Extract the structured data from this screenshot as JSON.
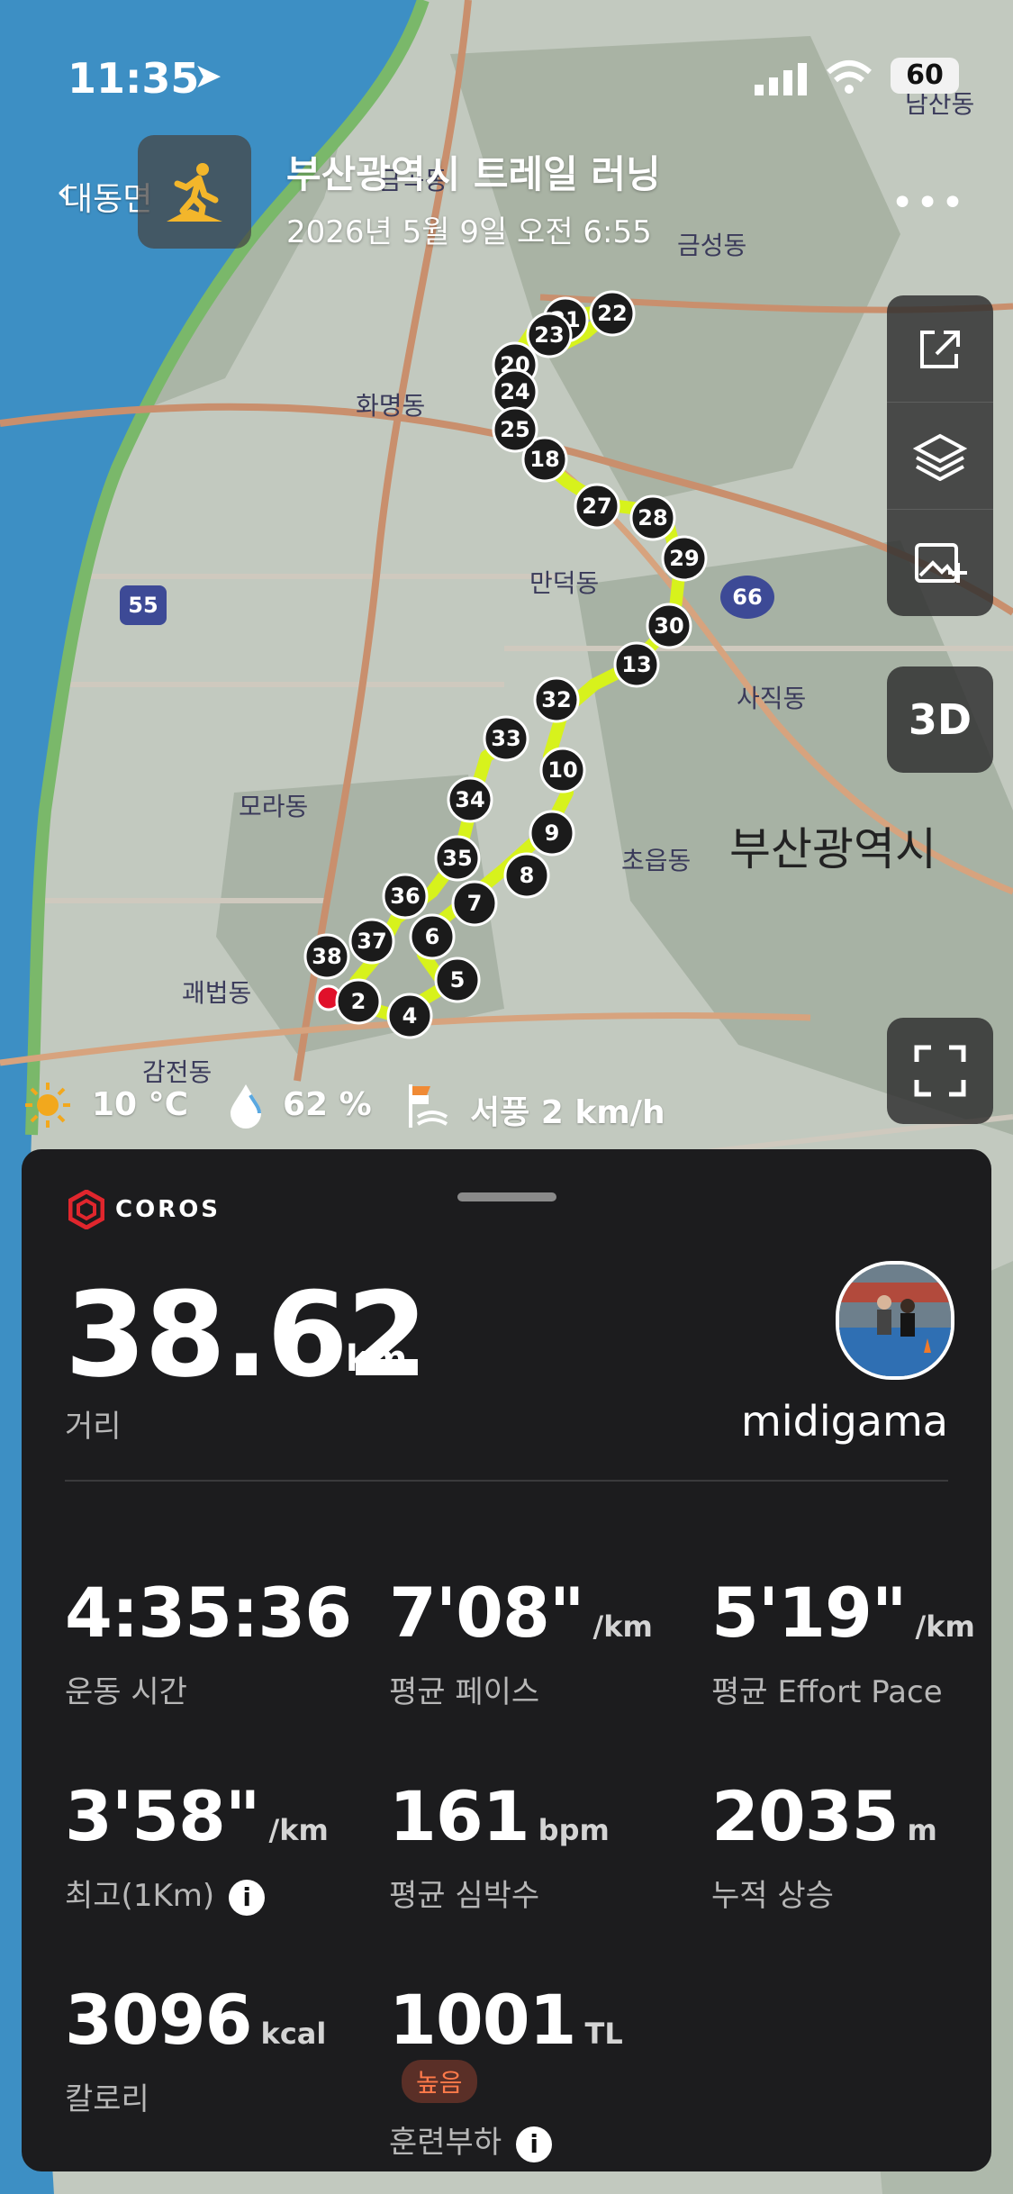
{
  "status_bar": {
    "time": "11:35",
    "battery": "60"
  },
  "header": {
    "back_label": "대동면",
    "title": "부산광역시 트레일 러닝",
    "subtitle": "2026년 5월 9일 오전 6:55"
  },
  "map": {
    "places": [
      "금곡동",
      "금성동",
      "화명동",
      "만덕동",
      "사직동",
      "모라동",
      "초읍동",
      "부산광역시",
      "괘법동",
      "감전동",
      "남산동"
    ],
    "road_labels": [
      "55",
      "66"
    ],
    "km_markers": [
      "2",
      "4",
      "5",
      "6",
      "7",
      "8",
      "9",
      "10",
      "13",
      "18",
      "20",
      "21",
      "22",
      "23",
      "24",
      "25",
      "27",
      "28",
      "29",
      "30",
      "32",
      "33",
      "34",
      "35",
      "36",
      "37",
      "38"
    ]
  },
  "map_controls": {
    "three_d_label": "3D"
  },
  "weather": {
    "temperature": "10 °C",
    "humidity": "62 %",
    "wind": "서풍 2 km/h"
  },
  "panel": {
    "brand": "COROS",
    "distance": {
      "value": "38.62",
      "unit": "km",
      "label": "거리"
    },
    "username": "midigama",
    "metrics": {
      "time": {
        "value": "4:35:36",
        "unit": "",
        "label": "운동 시간"
      },
      "avg_pace": {
        "value": "7'08\"",
        "unit": "/km",
        "label": "평균 페이스"
      },
      "effort_pace": {
        "value": "5'19\"",
        "unit": "/km",
        "label": "평균 Effort Pace"
      },
      "best_km": {
        "value": "3'58\"",
        "unit": "/km",
        "label": "최고(1Km)"
      },
      "avg_hr": {
        "value": "161",
        "unit": "bpm",
        "label": "평균 심박수"
      },
      "ascent": {
        "value": "2035",
        "unit": "m",
        "label": "누적 상승"
      },
      "calories": {
        "value": "3096",
        "unit": "kcal",
        "label": "칼로리"
      },
      "training_load": {
        "value": "1001",
        "unit": "TL",
        "label": "훈련부하",
        "badge": "높음"
      }
    }
  },
  "colors": {
    "route": "#d7f21c",
    "start_dot": "#e0102a",
    "panel_bg": "#1c1c1e",
    "river": "#3d8fc4",
    "badge_text": "#ff7a4a"
  }
}
